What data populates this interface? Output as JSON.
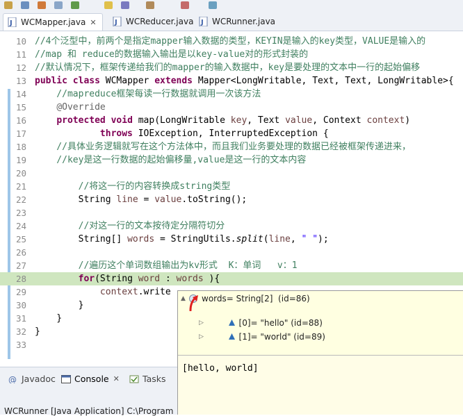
{
  "tabs": [
    {
      "label": "WCMapper.java",
      "active": true,
      "closable": true
    },
    {
      "label": "WCReducer.java",
      "active": false
    },
    {
      "label": "WCRunner.java",
      "active": false
    }
  ],
  "close_glyph": "✕",
  "code": {
    "lines": [
      {
        "n": "10",
        "t": "//4个泛型中，前两个是指定mapper输入数据的类型，KEYIN是输入的key类型，VALUE是输入的"
      },
      {
        "n": "11",
        "t": "//map 和 reduce的数据输入输出是以key-value对的形式封装的"
      },
      {
        "n": "12",
        "t": "//默认情况下，框架传递给我们的mapper的输入数据中，key是要处理的文本中一行的起始偏移"
      },
      {
        "n": "13",
        "t": "public class WCMapper extends Mapper<LongWritable, Text, Text, LongWritable>{"
      },
      {
        "n": "14",
        "t": "    //mapreduce框架每读一行数据就调用一次该方法"
      },
      {
        "n": "15",
        "t": "    @Override"
      },
      {
        "n": "16",
        "t": "    protected void map(LongWritable key, Text value, Context context)"
      },
      {
        "n": "17",
        "t": "            throws IOException, InterruptedException {"
      },
      {
        "n": "18",
        "t": "    //具体业务逻辑就写在这个方法体中，而且我们业务要处理的数据已经被框架传递进来，"
      },
      {
        "n": "19",
        "t": "    //key是这一行数据的起始偏移量,value是这一行的文本内容"
      },
      {
        "n": "20",
        "t": ""
      },
      {
        "n": "21",
        "t": "        //将这一行的内容转换成string类型"
      },
      {
        "n": "22",
        "t": "        String line = value.toString();"
      },
      {
        "n": "23",
        "t": ""
      },
      {
        "n": "24",
        "t": "        //对这一行的文本按待定分隔符切分"
      },
      {
        "n": "25",
        "t": "        String[] words = StringUtils.split(line, \" \");"
      },
      {
        "n": "26",
        "t": ""
      },
      {
        "n": "27",
        "t": "        //遍历这个单词数组输出为kv形式  K：单词   v：1"
      },
      {
        "n": "28",
        "t": "        for(String word : words ){"
      },
      {
        "n": "29",
        "t": "            context.write"
      },
      {
        "n": "30",
        "t": "        }"
      },
      {
        "n": "31",
        "t": "    }"
      },
      {
        "n": "32",
        "t": "}"
      },
      {
        "n": "33",
        "t": ""
      }
    ]
  },
  "debug_hover": {
    "root": "words= String[2]  (id=86)",
    "children": [
      {
        "label": "[0]= \"hello\" (id=88)"
      },
      {
        "label": "[1]= \"world\" (id=89)"
      }
    ],
    "detail": "[hello, world]"
  },
  "bottom_tabs": [
    {
      "label": "Javadoc"
    },
    {
      "label": "Console",
      "active": true
    },
    {
      "label": "Tasks"
    }
  ],
  "console_text": "WCRunner [Java Application] C:\\Program",
  "colors": {
    "comment": "#3f7f5f",
    "keyword": "#7f0055",
    "string": "#2a00ff",
    "current_line": "#cfe6bf",
    "hover_bg": "#ffffe1"
  }
}
